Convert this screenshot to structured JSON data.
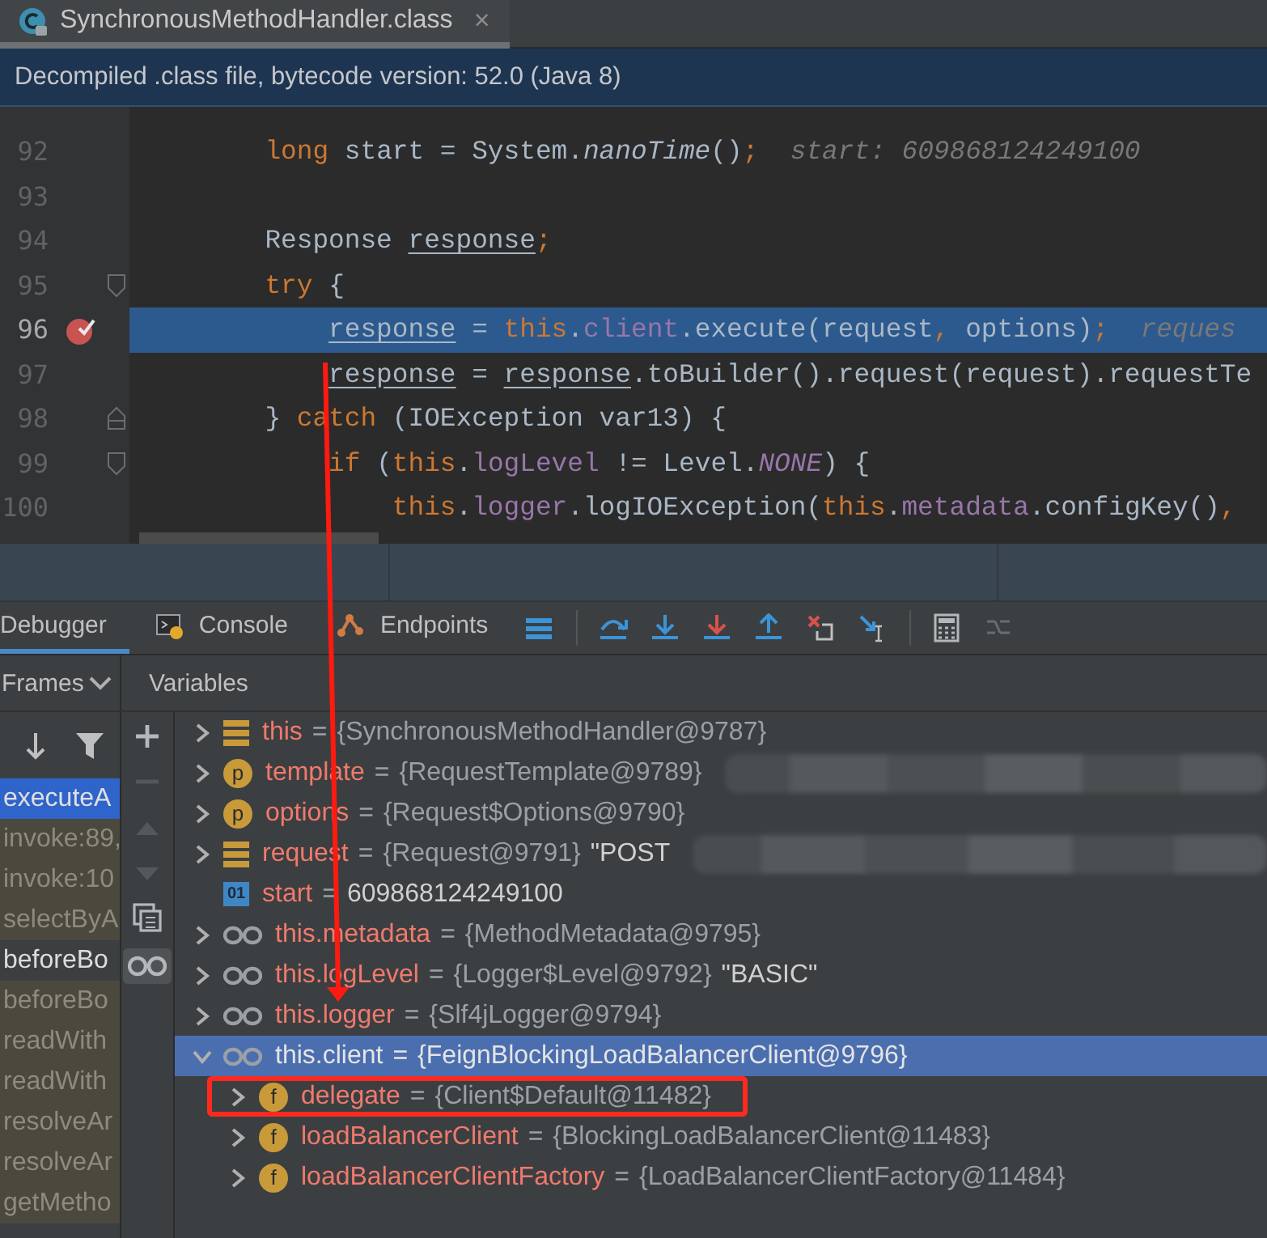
{
  "tab": {
    "title": "SynchronousMethodHandler.class",
    "close": "×"
  },
  "banner": "Decompiled .class file, bytecode version: 52.0 (Java 8)",
  "editor": {
    "lines": [
      {
        "number": "92",
        "current": false,
        "breakpoint": false,
        "fold_start": false,
        "fold_end": false,
        "tokens": [
          {
            "kind": "keyword",
            "t": "        long"
          },
          {
            "kind": "plain",
            "t": " start = System."
          },
          {
            "kind": "call",
            "t": "nanoTime"
          },
          {
            "kind": "plain",
            "t": "()"
          },
          {
            "kind": "keyword",
            "t": ";"
          },
          {
            "kind": "hint",
            "t": "  start: 609868124249100"
          }
        ]
      },
      {
        "number": "93",
        "current": false,
        "breakpoint": false,
        "fold_start": false,
        "fold_end": false
      },
      {
        "number": "94",
        "current": false,
        "breakpoint": false,
        "fold_start": false,
        "fold_end": false,
        "tokens": [
          {
            "kind": "plain",
            "t": "        Response "
          },
          {
            "kind": "var",
            "t": "response"
          },
          {
            "kind": "keyword",
            "t": ";"
          }
        ]
      },
      {
        "number": "95",
        "current": false,
        "breakpoint": false,
        "fold_start": true,
        "fold_end": false,
        "tokens": [
          {
            "kind": "keyword",
            "t": "        try"
          },
          {
            "kind": "plain",
            "t": " {"
          }
        ]
      },
      {
        "number": "96",
        "current": true,
        "breakpoint": true,
        "fold_start": false,
        "fold_end": false,
        "tokens": [
          {
            "kind": "var",
            "t": "            response"
          },
          {
            "kind": "plain",
            "t": " = "
          },
          {
            "kind": "keyword",
            "t": "this"
          },
          {
            "kind": "plain",
            "t": "."
          },
          {
            "kind": "field",
            "t": "client"
          },
          {
            "kind": "plain",
            "t": ".execute(request"
          },
          {
            "kind": "keyword",
            "t": ","
          },
          {
            "kind": "plain",
            "t": " options)"
          },
          {
            "kind": "keyword",
            "t": ";"
          },
          {
            "kind": "hint",
            "t": "  reques"
          }
        ]
      },
      {
        "number": "97",
        "current": false,
        "breakpoint": false,
        "fold_start": false,
        "fold_end": false,
        "tokens": [
          {
            "kind": "var",
            "t": "            response"
          },
          {
            "kind": "plain",
            "t": " = "
          },
          {
            "kind": "var",
            "t": "response"
          },
          {
            "kind": "plain",
            "t": ".toBuilder().request(request).requestTe"
          }
        ]
      },
      {
        "number": "98",
        "current": false,
        "breakpoint": false,
        "fold_start": true,
        "fold_end": true,
        "tokens": [
          {
            "kind": "plain",
            "t": "        } "
          },
          {
            "kind": "keyword",
            "t": "catch"
          },
          {
            "kind": "plain",
            "t": " (IOException var13) {"
          }
        ]
      },
      {
        "number": "99",
        "current": false,
        "breakpoint": false,
        "fold_start": true,
        "fold_end": false,
        "tokens": [
          {
            "kind": "keyword",
            "t": "            if"
          },
          {
            "kind": "plain",
            "t": " ("
          },
          {
            "kind": "keyword",
            "t": "this"
          },
          {
            "kind": "plain",
            "t": "."
          },
          {
            "kind": "field",
            "t": "logLevel"
          },
          {
            "kind": "plain",
            "t": " != Level."
          },
          {
            "kind": "static",
            "t": "NONE"
          },
          {
            "kind": "plain",
            "t": ") {"
          }
        ]
      },
      {
        "number": "100",
        "current": false,
        "breakpoint": false,
        "fold_start": false,
        "fold_end": false,
        "tokens": [
          {
            "kind": "keyword",
            "t": "                this"
          },
          {
            "kind": "plain",
            "t": "."
          },
          {
            "kind": "field",
            "t": "logger"
          },
          {
            "kind": "plain",
            "t": ".logIOException("
          },
          {
            "kind": "keyword",
            "t": "this"
          },
          {
            "kind": "plain",
            "t": "."
          },
          {
            "kind": "field",
            "t": "metadata"
          },
          {
            "kind": "plain",
            "t": ".configKey()"
          },
          {
            "kind": "keyword",
            "t": ","
          }
        ]
      }
    ]
  },
  "debug_tabs": [
    {
      "label": "Debugger",
      "kind": "debugger",
      "selected": true
    },
    {
      "label": "Console",
      "kind": "console",
      "selected": false
    },
    {
      "label": "Endpoints",
      "kind": "endpoints",
      "selected": false
    }
  ],
  "frames": {
    "title": "Frames",
    "items": [
      {
        "label": "executeA",
        "kind": "project",
        "selected": true
      },
      {
        "label": "invoke:89,",
        "kind": "library",
        "selected": false
      },
      {
        "label": "invoke:10",
        "kind": "library",
        "selected": false
      },
      {
        "label": "selectByA",
        "kind": "library",
        "selected": false
      },
      {
        "label": "beforeBo",
        "kind": "project",
        "selected": false
      },
      {
        "label": "beforeBo",
        "kind": "library",
        "selected": false
      },
      {
        "label": "readWith",
        "kind": "library",
        "selected": false
      },
      {
        "label": "readWith",
        "kind": "library",
        "selected": false
      },
      {
        "label": "resolveAr",
        "kind": "library",
        "selected": false
      },
      {
        "label": "resolveAr",
        "kind": "library",
        "selected": false
      },
      {
        "label": "getMetho",
        "kind": "library",
        "selected": false
      }
    ]
  },
  "variables": {
    "title": "Variables",
    "separator": "=",
    "items": [
      {
        "kind": "object",
        "name": "this",
        "value": "{SynchronousMethodHandler@9787}",
        "expandable": true,
        "expanded": false,
        "selected": false,
        "redacted": false
      },
      {
        "kind": "param",
        "badge": "p",
        "name": "template",
        "value": "{RequestTemplate@9789}",
        "expandable": true,
        "expanded": false,
        "selected": false,
        "redacted": true
      },
      {
        "kind": "param",
        "badge": "p",
        "name": "options",
        "value": "{Request$Options@9790}",
        "expandable": true,
        "expanded": false,
        "selected": false,
        "redacted": false
      },
      {
        "kind": "object",
        "name": "request",
        "value": "{Request@9791}",
        "extra": "\"POST",
        "expandable": true,
        "expanded": false,
        "selected": false,
        "redacted": true
      },
      {
        "kind": "primitive",
        "badge": "01",
        "name": "start",
        "value": "609868124249100",
        "expandable": false,
        "selected": false,
        "redacted": false
      },
      {
        "kind": "watch",
        "name": "this.metadata",
        "value": "{MethodMetadata@9795}",
        "expandable": true,
        "expanded": false,
        "selected": false,
        "redacted": false
      },
      {
        "kind": "watch",
        "name": "this.logLevel",
        "value": "{Logger$Level@9792}",
        "extra": "\"BASIC\"",
        "expandable": true,
        "expanded": false,
        "selected": false,
        "redacted": false
      },
      {
        "kind": "watch",
        "name": "this.logger",
        "value": "{Slf4jLogger@9794}",
        "expandable": true,
        "expanded": false,
        "selected": false,
        "redacted": false
      },
      {
        "kind": "watch",
        "name": "this.client",
        "value": "{FeignBlockingLoadBalancerClient@9796}",
        "expandable": true,
        "expanded": true,
        "selected": true,
        "redacted": false,
        "children": [
          {
            "kind": "field",
            "badge": "f",
            "name": "delegate",
            "value": "{Client$Default@11482}",
            "expandable": true,
            "expanded": false,
            "selected": false,
            "boxed": true
          },
          {
            "kind": "field",
            "badge": "f",
            "name": "loadBalancerClient",
            "value": "{BlockingLoadBalancerClient@11483}",
            "expandable": true,
            "expanded": false,
            "selected": false,
            "boxed": false
          },
          {
            "kind": "field",
            "badge": "f",
            "name": "loadBalancerClientFactory",
            "value": "{LoadBalancerClientFactory@11484}",
            "expandable": true,
            "expanded": false,
            "selected": false,
            "boxed": false
          }
        ]
      }
    ]
  },
  "annotations": {
    "arrow": true
  }
}
